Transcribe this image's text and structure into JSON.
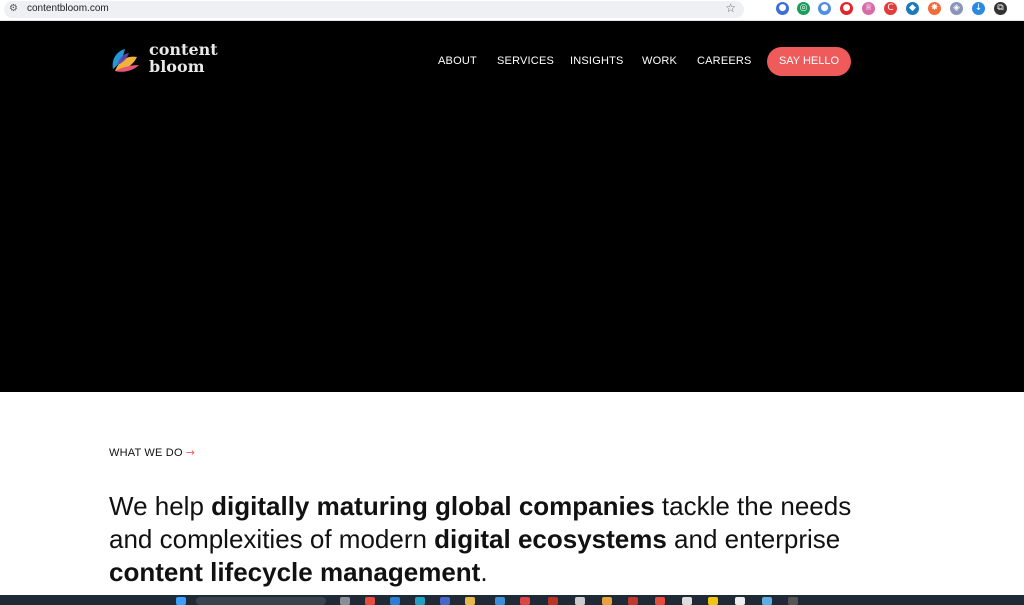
{
  "browser": {
    "url": "contentbloom.com",
    "extensions": [
      {
        "name": "ext-blue-icon",
        "color": "#3b6fd6",
        "glyph": "●"
      },
      {
        "name": "ext-green-icon",
        "color": "#1a9c5b",
        "glyph": "◎"
      },
      {
        "name": "ext-lightblue-icon",
        "color": "#4f8ee8",
        "glyph": "●"
      },
      {
        "name": "ext-red-icon",
        "color": "#e0262b",
        "glyph": "●"
      },
      {
        "name": "ext-crown-icon",
        "color": "#d86aa8",
        "glyph": "♕"
      },
      {
        "name": "ext-c-icon",
        "color": "#e33b3b",
        "glyph": "C"
      },
      {
        "name": "ext-teal-icon",
        "color": "#1b7ab8",
        "glyph": "◆"
      },
      {
        "name": "ext-orange-icon",
        "color": "#f26b38",
        "glyph": "✸"
      },
      {
        "name": "ext-shield-icon",
        "color": "#8a93b8",
        "glyph": "◈"
      },
      {
        "name": "ext-download-icon",
        "color": "#2a89e0",
        "glyph": "↓"
      },
      {
        "name": "ext-puzzle-icon",
        "color": "#333333",
        "glyph": "⧉"
      }
    ]
  },
  "logo": {
    "line1": "content",
    "line2": "bloom"
  },
  "nav": {
    "items": [
      {
        "label": "ABOUT"
      },
      {
        "label": "SERVICES"
      },
      {
        "label": "INSIGHTS"
      },
      {
        "label": "WORK"
      },
      {
        "label": "CAREERS"
      }
    ],
    "cta": "SAY HELLO"
  },
  "section": {
    "eyebrow": "WHAT WE DO",
    "arrow": "→",
    "headline": [
      {
        "text": "We help ",
        "bold": false
      },
      {
        "text": "digitally maturing global companies",
        "bold": true
      },
      {
        "text": " tackle the needs and complexities of modern ",
        "bold": false
      },
      {
        "text": "digital ecosystems",
        "bold": true
      },
      {
        "text": " and enterprise ",
        "bold": false
      },
      {
        "text": "content lifecycle management",
        "bold": true
      },
      {
        "text": ".",
        "bold": false
      }
    ]
  },
  "colors": {
    "accent": "#ef5b5b",
    "hero_bg": "#000000"
  }
}
